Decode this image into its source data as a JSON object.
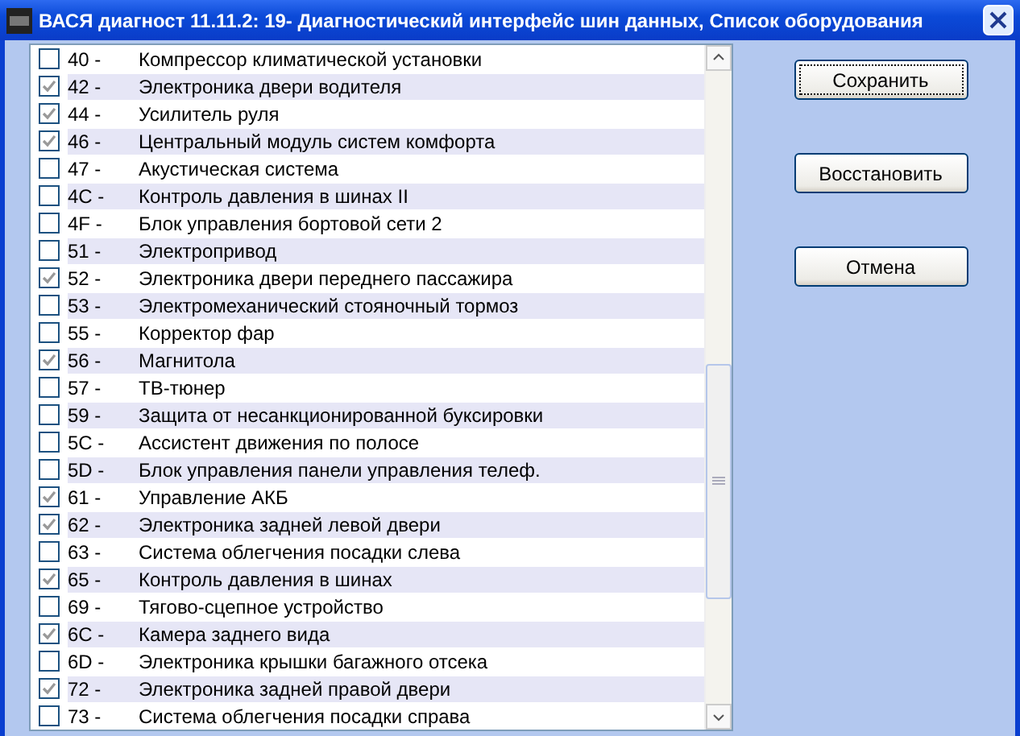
{
  "window": {
    "title": "ВАСЯ диагност 11.11.2: 19- Диагностический интерфейс шин данных,  Список оборудования"
  },
  "items": [
    {
      "code": "40 -",
      "name": "Компрессор климатической установки",
      "checked": false
    },
    {
      "code": "42 -",
      "name": "Электроника двери водителя",
      "checked": true
    },
    {
      "code": "44 -",
      "name": "Усилитель руля",
      "checked": true
    },
    {
      "code": "46 -",
      "name": "Центральный модуль систем комфорта",
      "checked": true
    },
    {
      "code": "47 -",
      "name": "Акустическая система",
      "checked": false
    },
    {
      "code": "4C -",
      "name": "Контроль давления в шинах II",
      "checked": false
    },
    {
      "code": "4F -",
      "name": "Блок управления бортовой сети 2",
      "checked": false
    },
    {
      "code": "51 -",
      "name": "Электропривод",
      "checked": false
    },
    {
      "code": "52 -",
      "name": "Электроника двери переднего пассажира",
      "checked": true
    },
    {
      "code": "53 -",
      "name": "Электромеханический стояночный тормоз",
      "checked": false
    },
    {
      "code": "55 -",
      "name": "Корректор фар",
      "checked": false
    },
    {
      "code": "56 -",
      "name": "Магнитола",
      "checked": true
    },
    {
      "code": "57 -",
      "name": "ТВ-тюнер",
      "checked": false
    },
    {
      "code": "59 -",
      "name": "Защита от несанкционированной буксировки",
      "checked": false
    },
    {
      "code": "5C -",
      "name": "Ассистент движения по полосе",
      "checked": false
    },
    {
      "code": "5D -",
      "name": "Блок управления панели управления телеф.",
      "checked": false
    },
    {
      "code": "61 -",
      "name": "Управление АКБ",
      "checked": true
    },
    {
      "code": "62 -",
      "name": "Электроника задней левой двери",
      "checked": true
    },
    {
      "code": "63 -",
      "name": "Система облегчения посадки слева",
      "checked": false
    },
    {
      "code": "65 -",
      "name": "Контроль давления в шинах",
      "checked": true
    },
    {
      "code": "69 -",
      "name": "Тягово-сцепное устройство",
      "checked": false
    },
    {
      "code": "6C -",
      "name": "Камера заднего вида",
      "checked": true
    },
    {
      "code": "6D -",
      "name": "Электроника крышки багажного отсека",
      "checked": false
    },
    {
      "code": "72 -",
      "name": "Электроника задней правой двери",
      "checked": true
    },
    {
      "code": "73 -",
      "name": "Система облегчения посадки справа",
      "checked": false
    }
  ],
  "buttons": [
    {
      "label": "Сохранить",
      "focused": true
    },
    {
      "label": "Восстановить",
      "focused": false
    },
    {
      "label": "Отмена",
      "focused": false
    }
  ]
}
